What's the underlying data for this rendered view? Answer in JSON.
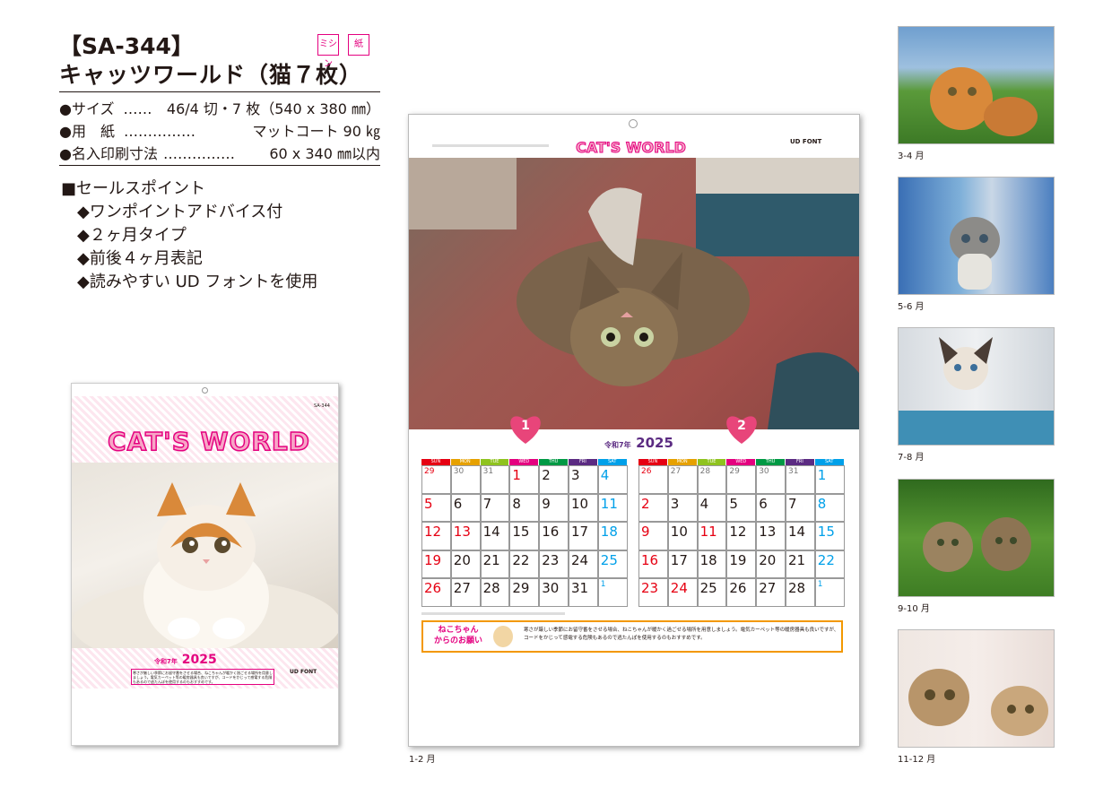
{
  "product": {
    "code": "【SA-344】",
    "name": "キャッツワールド（猫７枚）",
    "badges": [
      "ミシン",
      "紙"
    ]
  },
  "specs": [
    {
      "label": "●サイズ",
      "dots": "……",
      "value": "46/4 切・7 枚（540 x 380 ㎜）"
    },
    {
      "label": "●用　紙",
      "dots": "……………",
      "value": "マットコート 90 ㎏"
    },
    {
      "label": "●名入印刷寸法",
      "dots": "……………",
      "value": "60 x 340 ㎜以内"
    }
  ],
  "sales_points": {
    "heading": "■セールスポイント",
    "items": [
      "◆ワンポイントアドバイス付",
      "◆２ヶ月タイプ",
      "◆前後４ヶ月表記",
      "◆読みやすい UD フォントを使用"
    ]
  },
  "calendar": {
    "logo": "CAT'S WORLD",
    "era": "令和7年",
    "year": "2025",
    "corner_code": "SA-344",
    "weekdays": [
      "SUN",
      "MON",
      "TUE",
      "WED",
      "THU",
      "FRI",
      "SAT"
    ],
    "month1": "1",
    "month2": "2",
    "jan": [
      [
        "29",
        "30",
        "31",
        "1",
        "2",
        "3",
        "4"
      ],
      [
        "5",
        "6",
        "7",
        "8",
        "9",
        "10",
        "11"
      ],
      [
        "12",
        "13",
        "14",
        "15",
        "16",
        "17",
        "18"
      ],
      [
        "19",
        "20",
        "21",
        "22",
        "23",
        "24",
        "25"
      ],
      [
        "26",
        "27",
        "28",
        "29",
        "30",
        "31",
        "1"
      ]
    ],
    "feb": [
      [
        "26",
        "27",
        "28",
        "29",
        "30",
        "31",
        "1"
      ],
      [
        "2",
        "3",
        "4",
        "5",
        "6",
        "7",
        "8"
      ],
      [
        "9",
        "10",
        "11",
        "12",
        "13",
        "14",
        "15"
      ],
      [
        "16",
        "17",
        "18",
        "19",
        "20",
        "21",
        "22"
      ],
      [
        "23",
        "24",
        "25",
        "26",
        "27",
        "28",
        "1"
      ]
    ],
    "advice_title_1": "ねこちゃん",
    "advice_title_2": "からのお願い",
    "advice_text": "寒さが厳しい季節にお留守番をさせる場合、ねこちゃんが暖かく過ごせる場所を用意しましょう。電気カーペット等の暖房器具も良いですが、コードをかじって感電する危険もあるので逃たんぽを使用するのもおすすめです。",
    "ud_label": "UD FONT"
  },
  "colors": {
    "sun": "#e60012",
    "sat": "#00a0e9",
    "pink": "#e4007f",
    "heart": "#e8457a",
    "advice_border": "#f39800"
  },
  "captions": {
    "main": "1-2 月",
    "t1": "3-4 月",
    "t2": "5-6 月",
    "t3": "7-8 月",
    "t4": "9-10 月",
    "t5": "11-12 月"
  }
}
